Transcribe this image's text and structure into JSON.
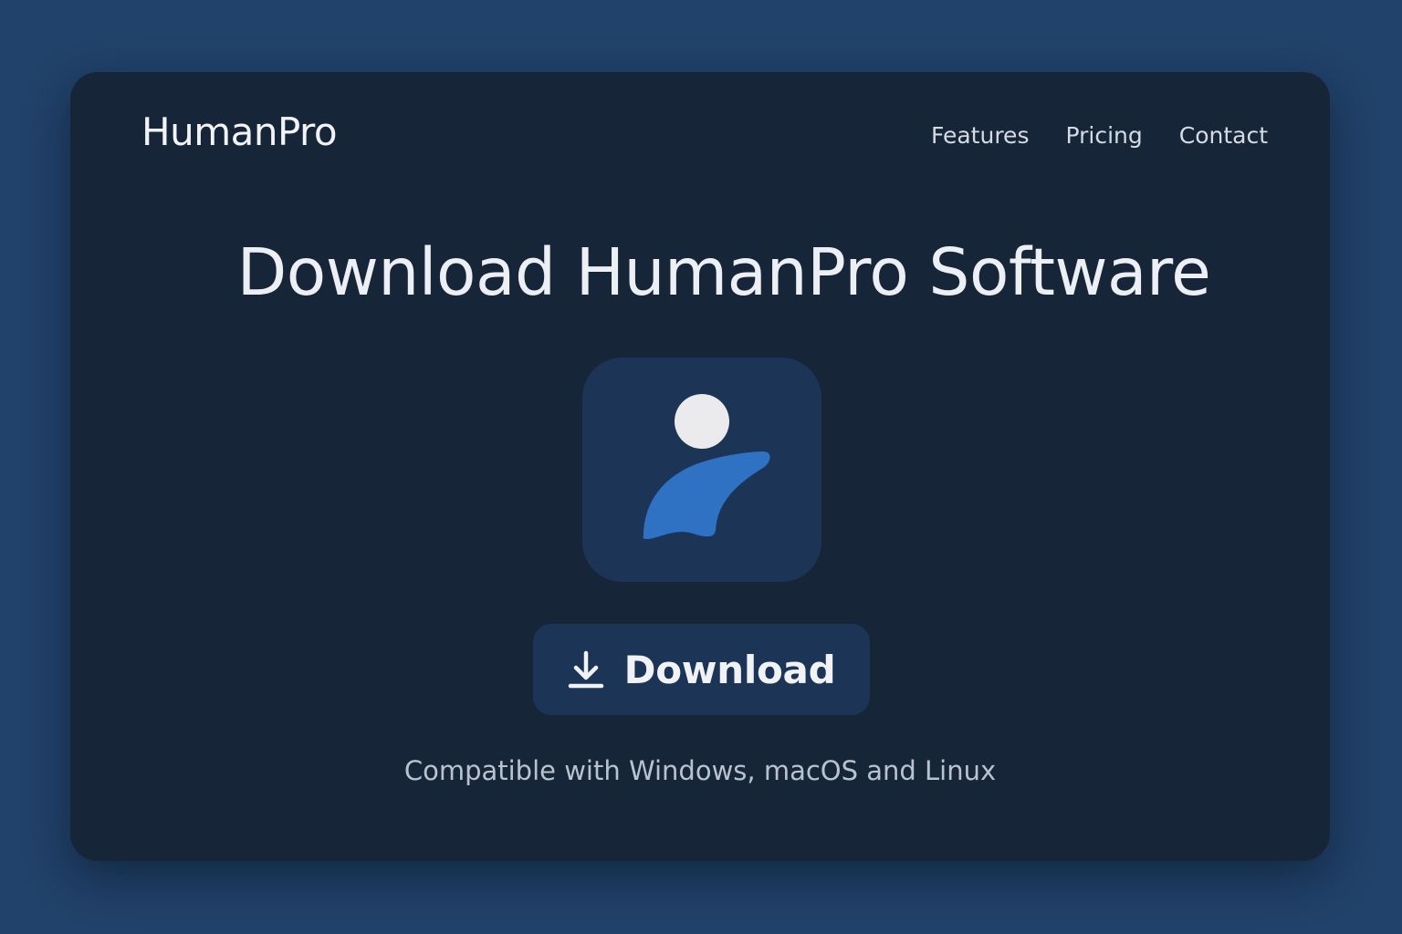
{
  "brand": {
    "name": "HumanPro"
  },
  "nav": {
    "items": [
      {
        "label": "Features"
      },
      {
        "label": "Pricing"
      },
      {
        "label": "Contact"
      }
    ]
  },
  "hero": {
    "title": "Download HumanPro Software",
    "app_icon": "person-logo-icon",
    "download_button": {
      "label": "Download",
      "icon": "download-icon"
    },
    "compatibility": "Compatible with Windows, macOS and Linux"
  },
  "colors": {
    "page_background": "#21426a",
    "card_background": "#172538",
    "tile_background": "#1c3556",
    "accent_blue": "#2f72c4",
    "text_primary": "#eceff3",
    "text_muted": "#b9c3cf"
  }
}
